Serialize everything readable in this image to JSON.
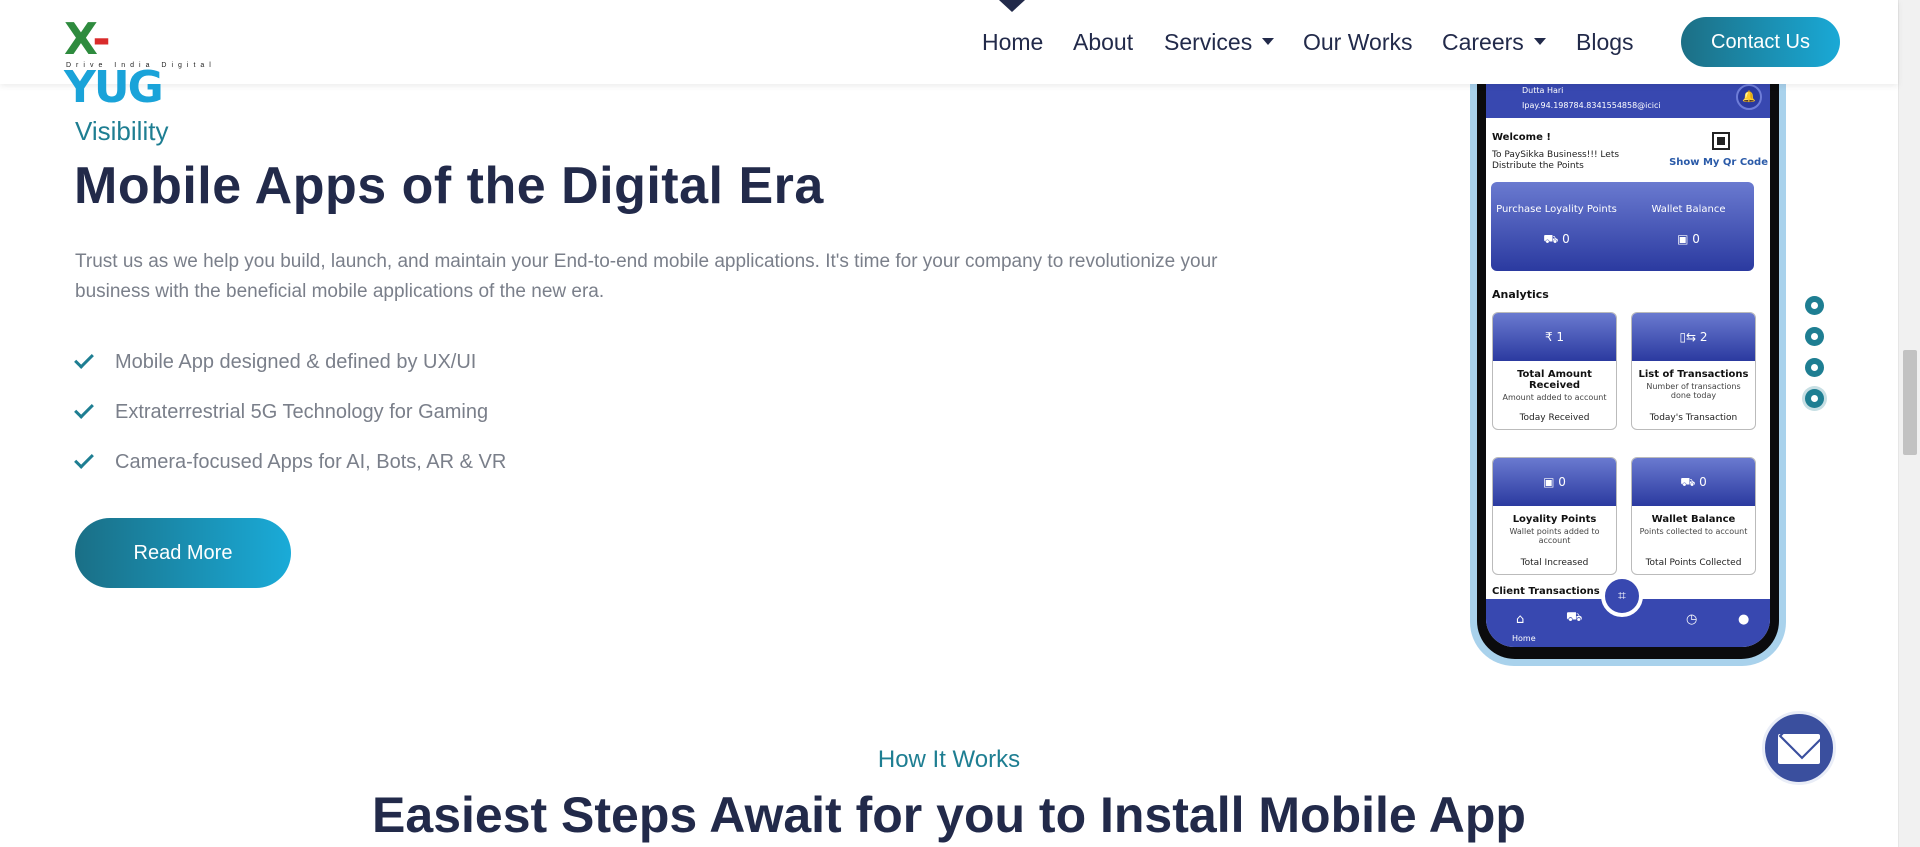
{
  "brand": {
    "logo_text": "X-YUG",
    "tagline": "Drive India Digital"
  },
  "nav": {
    "items": [
      {
        "label": "Home"
      },
      {
        "label": "About"
      },
      {
        "label": "Services"
      },
      {
        "label": "Our Works"
      },
      {
        "label": "Careers"
      },
      {
        "label": "Blogs"
      }
    ],
    "contact_label": "Contact Us"
  },
  "hero": {
    "eyebrow": "Visibility",
    "title": "Mobile Apps of the Digital Era",
    "description": "Trust us as we help you build, launch, and maintain your End-to-end mobile applications. It's time for your company to revolutionize your business with the beneficial mobile applications of the new era.",
    "features": [
      "Mobile App designed & defined by UX/UI",
      "Extraterrestrial 5G Technology for Gaming",
      "Camera-focused Apps for AI, Bots, AR & VR"
    ],
    "read_more_label": "Read More"
  },
  "phone": {
    "user_name": "Dutta Hari",
    "upi": "Ipay.94.198784.8341554858@icici",
    "welcome": "Welcome !",
    "welcome_sub": "To PaySikka Business!!! Lets Distribute the Points",
    "qr_label": "Show My Qr Code",
    "balance": {
      "left_label": "Purchase Loyality Points",
      "left_value": "0",
      "right_label": "Wallet Balance",
      "right_value": "0"
    },
    "analytics_label": "Analytics",
    "cards": [
      {
        "value": "1",
        "title": "Total Amount Received",
        "sub": "Amount added to account",
        "foot": "Today Received"
      },
      {
        "value": "2",
        "title": "List of Transactions",
        "sub": "Number of transactions done today",
        "foot": "Today's Transaction"
      },
      {
        "value": "0",
        "title": "Loyality Points",
        "sub": "Wallet points added to account",
        "foot": "Total Increased"
      },
      {
        "value": "0",
        "title": "Wallet Balance",
        "sub": "Points collected to account",
        "foot": "Total Points Collected"
      }
    ],
    "client_tx_label": "Client Transactions",
    "tab_home_label": "Home"
  },
  "carousel": {
    "count": 4,
    "active_index": 3
  },
  "how": {
    "eyebrow": "How It Works",
    "title": "Easiest Steps Await for you to Install Mobile App"
  },
  "colors": {
    "accent": "#1e7e92",
    "navy": "#222a4a",
    "app_blue": "#3848b0"
  }
}
